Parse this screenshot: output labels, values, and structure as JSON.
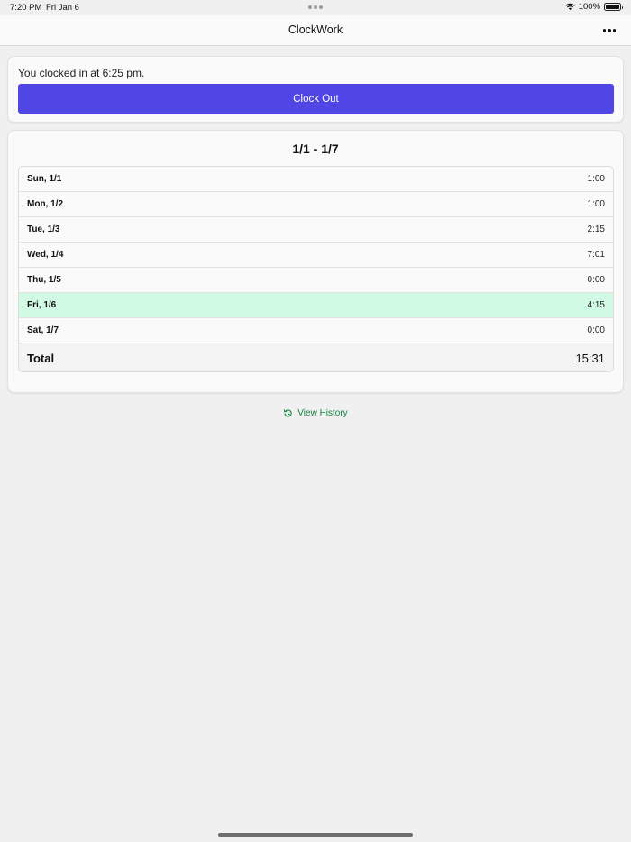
{
  "status_bar": {
    "time": "7:20 PM",
    "date": "Fri Jan 6",
    "battery": "100%"
  },
  "app": {
    "title": "ClockWork"
  },
  "clock": {
    "message": "You clocked in at 6:25 pm.",
    "button_label": "Clock Out",
    "button_color": "#4f46e5"
  },
  "week": {
    "range": "1/1 - 1/7",
    "days": [
      {
        "label": "Sun, 1/1",
        "hours": "1:00"
      },
      {
        "label": "Mon, 1/2",
        "hours": "1:00"
      },
      {
        "label": "Tue, 1/3",
        "hours": "2:15"
      },
      {
        "label": "Wed, 1/4",
        "hours": "7:01"
      },
      {
        "label": "Thu, 1/5",
        "hours": "0:00"
      },
      {
        "label": "Fri, 1/6",
        "hours": "4:15",
        "highlighted": true
      },
      {
        "label": "Sat, 1/7",
        "hours": "0:00"
      }
    ],
    "total_label": "Total",
    "total_hours": "15:31",
    "highlight_color": "#d1fae5"
  },
  "history_link": {
    "label": "View History",
    "icon": "history-icon",
    "color": "#15803d"
  }
}
